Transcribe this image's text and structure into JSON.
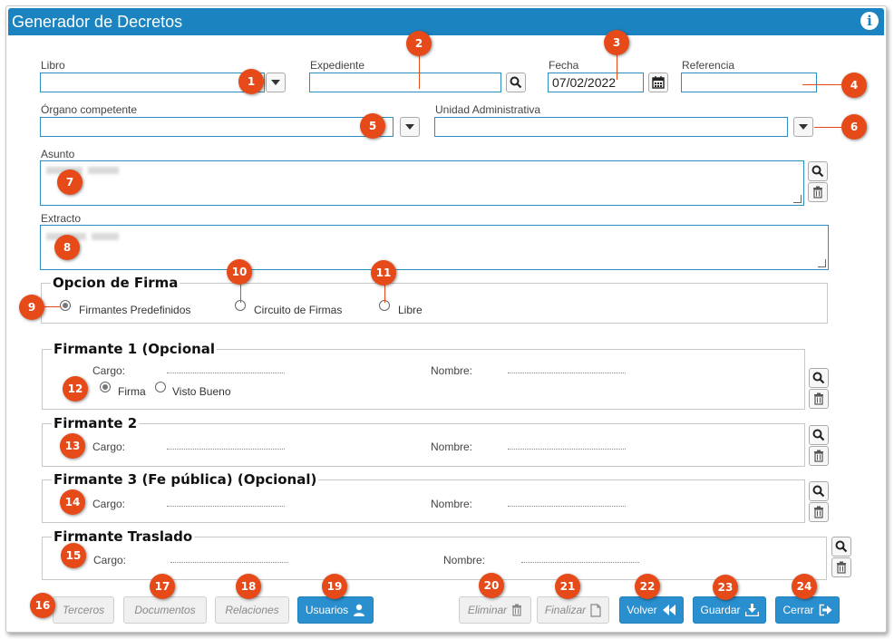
{
  "window": {
    "title": "Generador de Decretos"
  },
  "fields": {
    "libro": {
      "label": "Libro",
      "value": ""
    },
    "expediente": {
      "label": "Expediente",
      "value": ""
    },
    "fecha": {
      "label": "Fecha",
      "value": "07/02/2022"
    },
    "referencia": {
      "label": "Referencia",
      "value": ""
    },
    "organo": {
      "label": "Órgano competente",
      "value": ""
    },
    "unidad": {
      "label": "Unidad Administrativa",
      "value": ""
    },
    "asunto": {
      "label": "Asunto"
    },
    "extracto": {
      "label": "Extracto"
    }
  },
  "opcion_firma": {
    "legend": "Opcion de Firma",
    "options": [
      "Firmantes Predefinidos",
      "Circuito de Firmas",
      "Libre"
    ],
    "selected": "Firmantes Predefinidos"
  },
  "firmantes": [
    {
      "legend": "Firmante 1 (Opcional",
      "cargo_label": "Cargo:",
      "nombre_label": "Nombre:",
      "radio": [
        "Firma",
        "Visto Bueno"
      ],
      "radio_selected": "Firma"
    },
    {
      "legend": "Firmante 2",
      "cargo_label": "Cargo:",
      "nombre_label": "Nombre:"
    },
    {
      "legend": "Firmante 3 (Fe pública) (Opcional)",
      "cargo_label": "Cargo:",
      "nombre_label": "Nombre:"
    },
    {
      "legend": "Firmante Traslado",
      "cargo_label": "Cargo:",
      "nombre_label": "Nombre:"
    }
  ],
  "actions": {
    "terceros": "Terceros",
    "documentos": "Documentos",
    "relaciones": "Relaciones",
    "usuarios": "Usuarios",
    "eliminar": "Eliminar",
    "finalizar": "Finalizar",
    "volver": "Volver",
    "guardar": "Guardar",
    "cerrar": "Cerrar"
  },
  "callouts": [
    "1",
    "2",
    "3",
    "4",
    "5",
    "6",
    "7",
    "8",
    "9",
    "10",
    "11",
    "12",
    "13",
    "14",
    "15",
    "16",
    "17",
    "18",
    "19",
    "20",
    "21",
    "22",
    "23",
    "24"
  ],
  "colors": {
    "titlebar": "#1a83c0",
    "primary_button": "#2a8fce",
    "callout": "#e64a19",
    "input_border": "#2a8fbf"
  }
}
